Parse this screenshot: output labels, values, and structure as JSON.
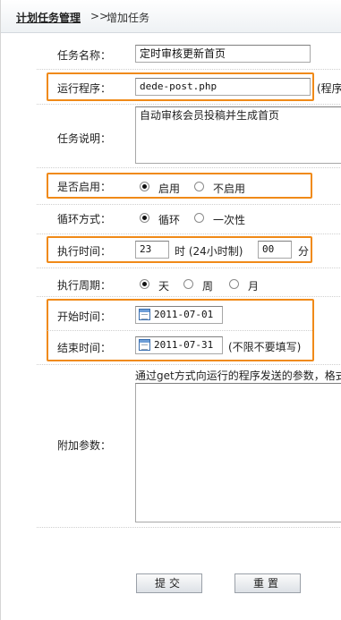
{
  "breadcrumb": {
    "root": "计划任务管理",
    "separator": ">>",
    "current": "增加任务"
  },
  "form": {
    "task_name": {
      "label": "任务名称：",
      "value": "定时审核更新首页"
    },
    "program": {
      "label": "运行程序：",
      "value": "dede-post.php",
      "hint": "(程序"
    },
    "description": {
      "label": "任务说明：",
      "value": "自动审核会员投稿并生成首页"
    },
    "enabled": {
      "label": "是否启用：",
      "options": [
        "启用",
        "不启用"
      ],
      "selected": "启用"
    },
    "loop": {
      "label": "循环方式：",
      "options": [
        "循环",
        "一次性"
      ],
      "selected": "循环"
    },
    "exec_time": {
      "label": "执行时间：",
      "hour": "23",
      "hour_unit": "时 (24小时制)",
      "minute": "00",
      "minute_unit": "分"
    },
    "period": {
      "label": "执行周期：",
      "options": [
        "天",
        "周",
        "月"
      ],
      "selected": "天"
    },
    "start_time": {
      "label": "开始时间：",
      "value": "2011-07-01"
    },
    "end_time": {
      "label": "结束时间：",
      "value": "2011-07-31",
      "hint": "(不限不要填写)"
    },
    "params": {
      "label": "附加参数：",
      "hint": "通过get方式向运行的程序发送的参数，格式",
      "value": ""
    }
  },
  "buttons": {
    "submit": "提交",
    "reset": "重置"
  },
  "colors": {
    "highlight": "#f08a18",
    "border": "#a7a7a7"
  }
}
